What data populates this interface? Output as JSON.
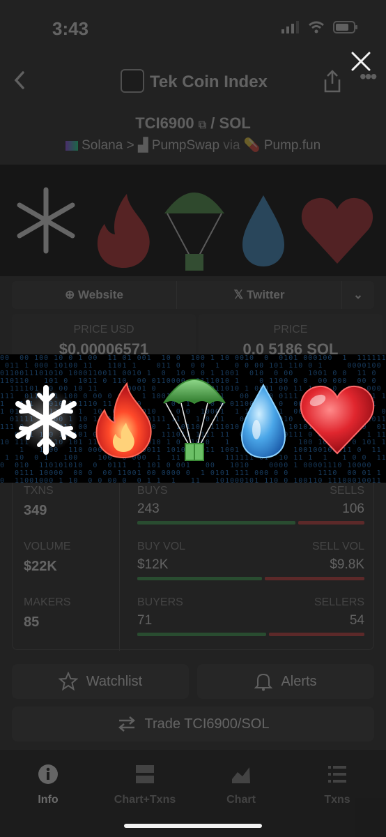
{
  "status_bar": {
    "time": "3:43"
  },
  "header": {
    "title": "Tek Coin Index"
  },
  "pair": {
    "base": "TCI6900",
    "quote": "SOL"
  },
  "chain": {
    "network": "Solana",
    "dex": "PumpSwap",
    "via": "via",
    "source": "Pump.fun"
  },
  "links": {
    "website": "Website",
    "twitter": "Twitter"
  },
  "price": {
    "usd_label": "PRICE USD",
    "usd_value": "$0.00006571",
    "native_label": "PRICE",
    "native_value": "0.0 5186 SOL"
  },
  "stats": {
    "txns_label": "TXNS",
    "txns_value": "349",
    "volume_label": "VOLUME",
    "volume_value": "$22K",
    "makers_label": "MAKERS",
    "makers_value": "85",
    "buys_label": "BUYS",
    "buys_value": "243",
    "sells_label": "SELLS",
    "sells_value": "106",
    "buy_vol_label": "BUY VOL",
    "buy_vol_value": "$12K",
    "sell_vol_label": "SELL VOL",
    "sell_vol_value": "$9.8K",
    "buyers_label": "BUYERS",
    "buyers_value": "71",
    "sellers_label": "SELLERS",
    "sellers_value": "54",
    "buys_fraction": 0.696,
    "buy_vol_fraction": 0.55,
    "buyers_fraction": 0.568
  },
  "actions": {
    "watchlist": "Watchlist",
    "alerts": "Alerts",
    "trade": "Trade TCI6900/SOL"
  },
  "nav": {
    "info": "Info",
    "chart_txns": "Chart+Txns",
    "chart": "Chart",
    "txns": "Txns"
  },
  "overlay_icons": [
    "snowflake-icon",
    "fire-icon",
    "parachute-icon",
    "water-drop-icon",
    "heart-icon"
  ],
  "colors": {
    "buy": "#3aa24d",
    "sell": "#d13a3a",
    "background": "#000000"
  }
}
